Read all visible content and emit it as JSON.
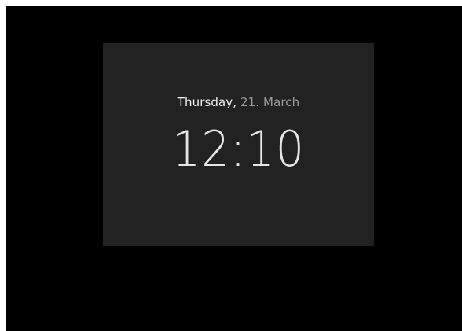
{
  "lockscreen": {
    "date": {
      "weekday": "Thursday,",
      "day_month": " 21. March"
    },
    "time": "12:10"
  },
  "colors": {
    "outer_background": "#000000",
    "panel_background": "#222222",
    "weekday_text": "#f2f2f2",
    "date_text": "#9a9a9a",
    "time_text": "#e6e6e6"
  }
}
